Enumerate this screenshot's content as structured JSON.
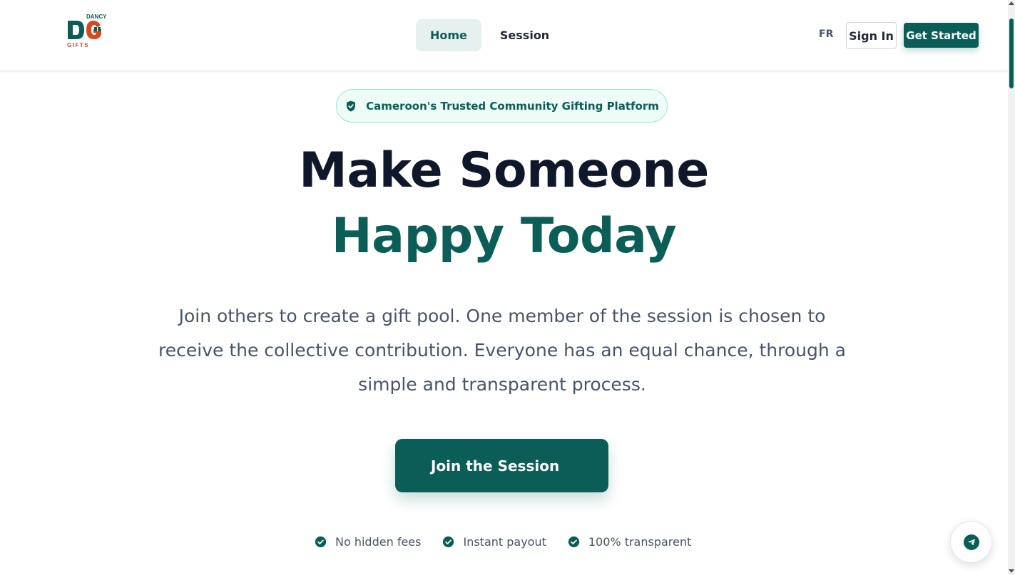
{
  "header": {
    "logo": {
      "top_text": "DANCY",
      "initials": "DG",
      "bottom_text": "GIFTS"
    },
    "nav": [
      {
        "label": "Home",
        "active": true
      },
      {
        "label": "Session",
        "active": false
      }
    ],
    "language": "FR",
    "sign_in_label": "Sign In",
    "get_started_label": "Get Started"
  },
  "hero": {
    "badge": {
      "icon": "shield-check-icon",
      "text": "Cameroon's Trusted Community Gifting Platform"
    },
    "title_line1": "Make Someone",
    "title_line2": "Happy Today",
    "description": "Join others to create a gift pool. One member of the session is chosen to receive the collective contribution. Everyone has an equal chance, through a simple and transparent process.",
    "cta_label": "Join the Session",
    "features": [
      {
        "icon": "check-circle-icon",
        "text": "No hidden fees"
      },
      {
        "icon": "check-circle-icon",
        "text": "Instant payout"
      },
      {
        "icon": "check-circle-icon",
        "text": "100% transparent"
      }
    ]
  },
  "floating_button": {
    "icon": "send-icon"
  },
  "colors": {
    "primary": "#0b5e58",
    "dark_text": "#0f172a",
    "muted_text": "#475569",
    "badge_bg": "#edfcf7",
    "badge_border": "#99e6d6",
    "logo_red": "#d9481e"
  }
}
